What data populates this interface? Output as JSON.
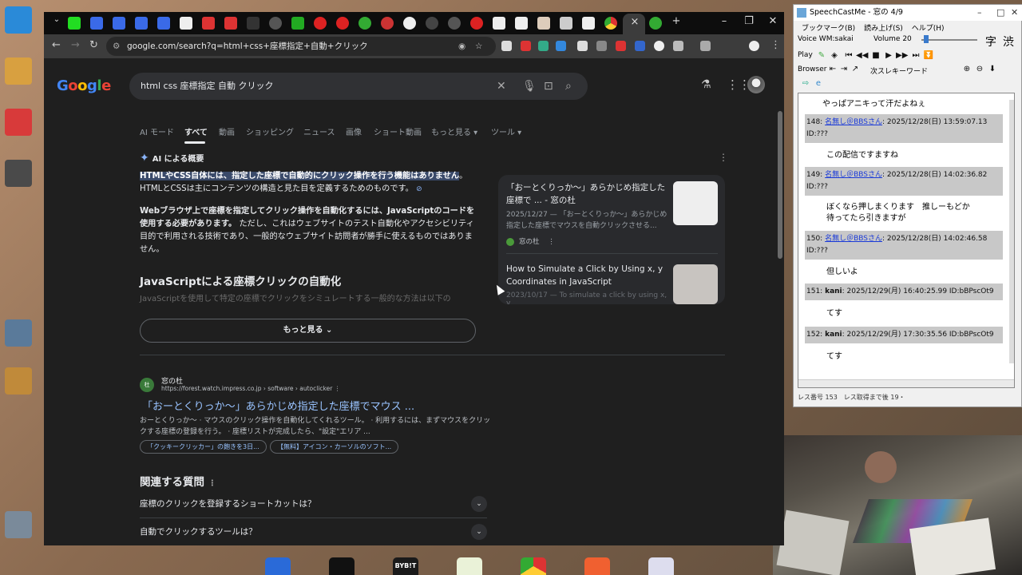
{
  "browser": {
    "url": "google.com/search?q=html+css+座標指定+自動+クリック&newwindow=1&sca_esv=5fc6a171bfa...",
    "new_tab": "+",
    "close_tab": "×"
  },
  "google": {
    "logo": "Google",
    "query": "html css 座標指定 自動 クリック",
    "tabs": [
      "AI モード",
      "すべて",
      "動画",
      "ショッピング",
      "ニュース",
      "画像",
      "ショート動画",
      "もっと見る ▾",
      "ツール ▾"
    ]
  },
  "ai_overview": {
    "heading": "AI による概要",
    "p1_highlight": "HTMLやCSS自体には、指定した座標で自動的にクリック操作を行う機能はありません",
    "p1_rest": "。HTMLとCSSは主にコンテンツの構造と見た目を定義するためのものです。",
    "p2_bold": "Webブラウザ上で座標を指定してクリック操作を自動化するには、JavaScriptのコードを使用する必要があります。",
    "p2_rest": " ただし、これはウェブサイトのテスト自動化やアクセシビリティ目的で利用される技術であり、一般的なウェブサイト訪問者が勝手に使えるものではありません。",
    "section_title": "JavaScriptによる座標クリックの自動化",
    "faded": "JavaScriptを使用して特定の座標でクリックをシミュレートする一般的な方法は以下の",
    "show_more": "もっと見る"
  },
  "side_cards": [
    {
      "title": "「おーとくりっか～」あらかじめ指定した座標で ... - 窓の杜",
      "desc": "2025/12/27 — 「おーとくりっか～」あらかじめ指定した座標でマウスを自動クリックさせる...",
      "source": "窓の杜"
    },
    {
      "title": "How to Simulate a Click by Using x, y Coordinates in JavaScript",
      "desc": "2023/10/17 — To simulate a click by using x, y"
    }
  ],
  "result": {
    "site": "窓の杜",
    "url": "https://forest.watch.impress.co.jp › software › autoclicker",
    "title": "「おーとくりっか～」あらかじめ指定した座標でマウス ...",
    "snippet": "おーとくりっか～ · マウスのクリック操作を自動化してくれるツール。 · 利用するには、まずマウスをクリックする座標の登録を行う。 · 座標リストが完成したら、\"設定\"エリア ...",
    "chips": [
      "「クッキークリッカー」の飽きを3日...",
      "【無料】アイコン・カーソルのソフト..."
    ]
  },
  "paa": {
    "heading": "関連する質問",
    "questions": [
      "座標のクリックを登録するショートカットは？",
      "自動でクリックするツールは？"
    ]
  },
  "speechcast": {
    "title": "SpeechCastMe - 窓の 4/9",
    "menu": [
      "ブックマーク(B)",
      "読み上げ(S)",
      "ヘルプ(H)"
    ],
    "voice": "Voice WM:sakai",
    "volume": "Volume 20",
    "labels": [
      "字",
      "渋"
    ],
    "play": "Play",
    "browser": "Browser",
    "keyword": "次スレキーワード",
    "first_line": "やっぱアニキって汗だよねぇ",
    "posts": [
      {
        "head_no": "148:",
        "name": "名無し＠BBSさん",
        "meta": ": 2025/12/28(日) 13:59:07.13 ID:???",
        "body": "この配信ですますね"
      },
      {
        "head_no": "149:",
        "name": "名無し＠BBSさん",
        "meta": ": 2025/12/28(日) 14:02:36.82 ID:???",
        "body": "ぼくなら押しまくります　推しーもどか待ってたら引きますが"
      },
      {
        "head_no": "150:",
        "name": "名無し＠BBSさん",
        "meta": ": 2025/12/28(日) 14:02:46.58 ID:???",
        "body": "但しいよ"
      },
      {
        "head_no": "151:",
        "name": "kani",
        "meta": ": 2025/12/29(月) 16:40:25.99 ID:bBPscOt9",
        "body": "てす"
      },
      {
        "head_no": "152:",
        "name": "kani",
        "meta": ": 2025/12/29(月) 17:30:35.56 ID:bBPscOt9",
        "body": "てす"
      }
    ],
    "status": "レス番号 153　レス取得まで後 19・"
  },
  "colors": {
    "google_bg": "#1f1f1f",
    "link": "#99c3ff",
    "highlight": "#3a4a6a"
  }
}
